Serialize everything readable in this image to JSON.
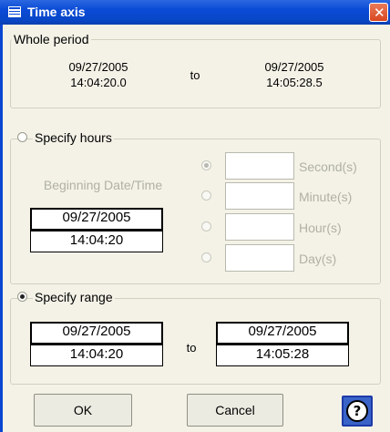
{
  "window": {
    "title": "Time axis",
    "close_glyph": "✕"
  },
  "whole_period": {
    "legend": "Whole period",
    "start_date": "09/27/2005",
    "start_time": "14:04:20.0",
    "to": "to",
    "end_date": "09/27/2005",
    "end_time": "14:05:28.5"
  },
  "specify_hours": {
    "legend": "Specify hours",
    "beginning_label": "Beginning Date/Time",
    "date": "09/27/2005",
    "time": "14:04:20",
    "units": [
      {
        "label": "Second(s)",
        "selected": true,
        "value": ""
      },
      {
        "label": "Minute(s)",
        "selected": false,
        "value": ""
      },
      {
        "label": "Hour(s)",
        "selected": false,
        "value": ""
      },
      {
        "label": "Day(s)",
        "selected": false,
        "value": ""
      }
    ]
  },
  "specify_range": {
    "legend": "Specify range",
    "start_date": "09/27/2005",
    "start_time": "14:04:20",
    "to": "to",
    "end_date": "09/27/2005",
    "end_time": "14:05:28"
  },
  "buttons": {
    "ok": "OK",
    "cancel": "Cancel",
    "help_glyph": "?"
  },
  "icons": {
    "title_icon": "window-icon",
    "help_icon": "help-icon"
  },
  "colors": {
    "titlebar": "#0a4bd6",
    "dialog_bg": "#f4f2e7",
    "close": "#d9461f"
  }
}
